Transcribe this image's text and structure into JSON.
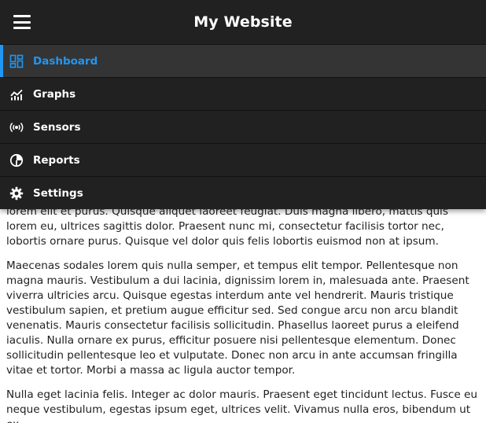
{
  "header": {
    "title": "My Website",
    "menu_icon": "hamburger-icon"
  },
  "colors": {
    "header_bg": "#212121",
    "drawer_bg": "#212121",
    "active_bg": "#343434",
    "accent": "#2196f3",
    "text": "#212121"
  },
  "drawer": {
    "items": [
      {
        "label": "Dashboard",
        "icon": "dashboard-icon",
        "active": true
      },
      {
        "label": "Graphs",
        "icon": "chart-icon",
        "active": false
      },
      {
        "label": "Sensors",
        "icon": "sensor-icon",
        "active": false
      },
      {
        "label": "Reports",
        "icon": "pie-chart-icon",
        "active": false
      },
      {
        "label": "Settings",
        "icon": "gear-icon",
        "active": false
      }
    ]
  },
  "content": {
    "paragraphs": [
      "lorem elit et purus. Quisque aliquet laoreet feugiat. Duis magna libero, mattis quis lorem eu, ultrices sagittis dolor. Praesent nunc mi, consectetur facilisis tortor nec, lobortis ornare purus. Quisque vel dolor quis felis lobortis euismod non at ipsum.",
      "Maecenas sodales lorem quis nulla semper, et tempus elit tempor. Pellentesque non magna mauris. Vestibulum a dui lacinia, dignissim lorem in, malesuada ante. Praesent viverra ultricies arcu. Quisque egestas interdum ante vel hendrerit. Mauris tristique vestibulum sapien, et pretium augue efficitur sed. Sed congue arcu non arcu blandit venenatis. Mauris consectetur facilisis sollicitudin. Phasellus laoreet purus a eleifend iaculis. Nulla ornare ex purus, efficitur posuere nisi pellentesque elementum. Donec sollicitudin pellentesque leo et vulputate. Donec non arcu in ante accumsan fringilla vitae et tortor. Morbi a massa ac ligula auctor tempor.",
      "Nulla eget lacinia felis. Integer ac dolor mauris. Praesent eget tincidunt lectus. Fusce eu neque vestibulum, egestas ipsum eget, ultrices velit. Vivamus nulla eros, bibendum ut ex"
    ]
  }
}
